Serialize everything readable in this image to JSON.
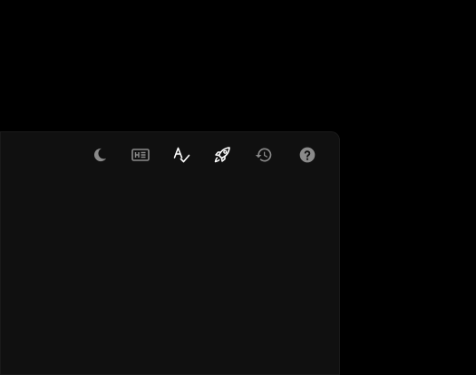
{
  "toolbar": {
    "buttons": [
      {
        "id": "theme",
        "icon": "moon-icon",
        "color": "#8a8a8a"
      },
      {
        "id": "heading",
        "icon": "heading-icon",
        "color": "#8a8a8a"
      },
      {
        "id": "spellcheck",
        "icon": "spellcheck-icon",
        "color": "#ffffff"
      },
      {
        "id": "launch",
        "icon": "rocket-icon",
        "color": "#ffffff"
      },
      {
        "id": "history",
        "icon": "history-icon",
        "color": "#8a8a8a"
      },
      {
        "id": "help",
        "icon": "help-icon",
        "color": "#8a8a8a"
      }
    ]
  },
  "colors": {
    "page_background": "#000000",
    "panel_background": "#101010",
    "icon_active": "#ffffff",
    "icon_inactive": "#8a8a8a"
  }
}
